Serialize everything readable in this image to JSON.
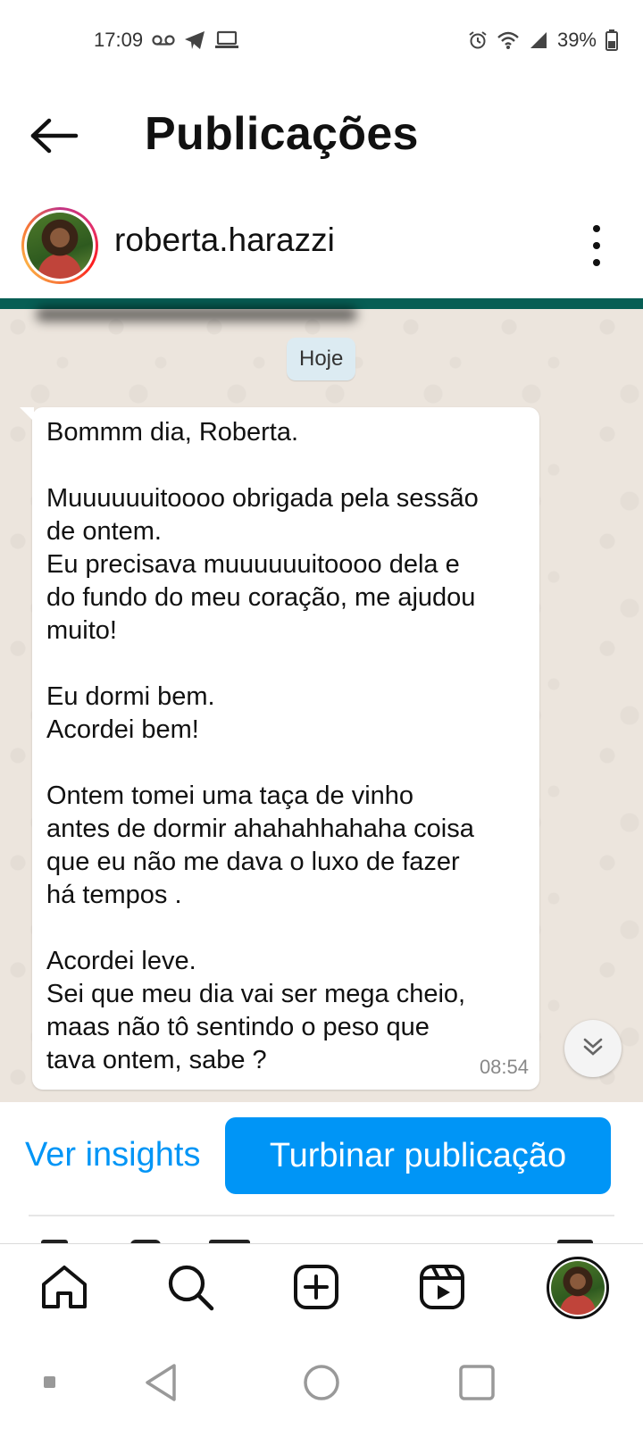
{
  "status_bar": {
    "time": "17:09",
    "battery": "39%",
    "icons": [
      "voicemail-icon",
      "telegram-icon",
      "laptop-icon",
      "alarm-icon",
      "wifi-icon",
      "signal-icon",
      "battery-icon"
    ]
  },
  "header": {
    "title": "Publicações",
    "back_icon": "arrow-left-icon"
  },
  "post": {
    "username": "roberta.harazzi",
    "more_icon": "more-vertical-icon"
  },
  "image_content": {
    "date_chip": "Hoje",
    "message_lines": [
      "Bommm dia, Roberta.",
      "",
      "Muuuuuuitoooo obrigada pela sessão",
      "de ontem.",
      "Eu precisava muuuuuuitoooo dela e",
      "do fundo do meu coração, me ajudou",
      "muito!",
      "",
      "Eu dormi bem.",
      "Acordei bem!",
      "",
      "Ontem tomei uma taça de vinho",
      "antes de dormir ahahahhahaha coisa",
      "que eu não me dava o luxo de fazer",
      "há tempos .",
      "",
      "Acordei leve.",
      "Sei que meu dia vai ser mega cheio,",
      "maas não tô sentindo o peso que",
      "tava ontem, sabe ?"
    ],
    "message_time": "08:54"
  },
  "actions": {
    "insights_label": "Ver insights",
    "boost_label": "Turbinar publicação"
  },
  "bottom_nav": {
    "items": [
      "home-icon",
      "search-icon",
      "create-icon",
      "reels-icon",
      "profile-avatar"
    ]
  },
  "colors": {
    "accent": "#0095f6",
    "whatsapp_bg": "#ece5dd",
    "whatsapp_header": "#075e54"
  }
}
